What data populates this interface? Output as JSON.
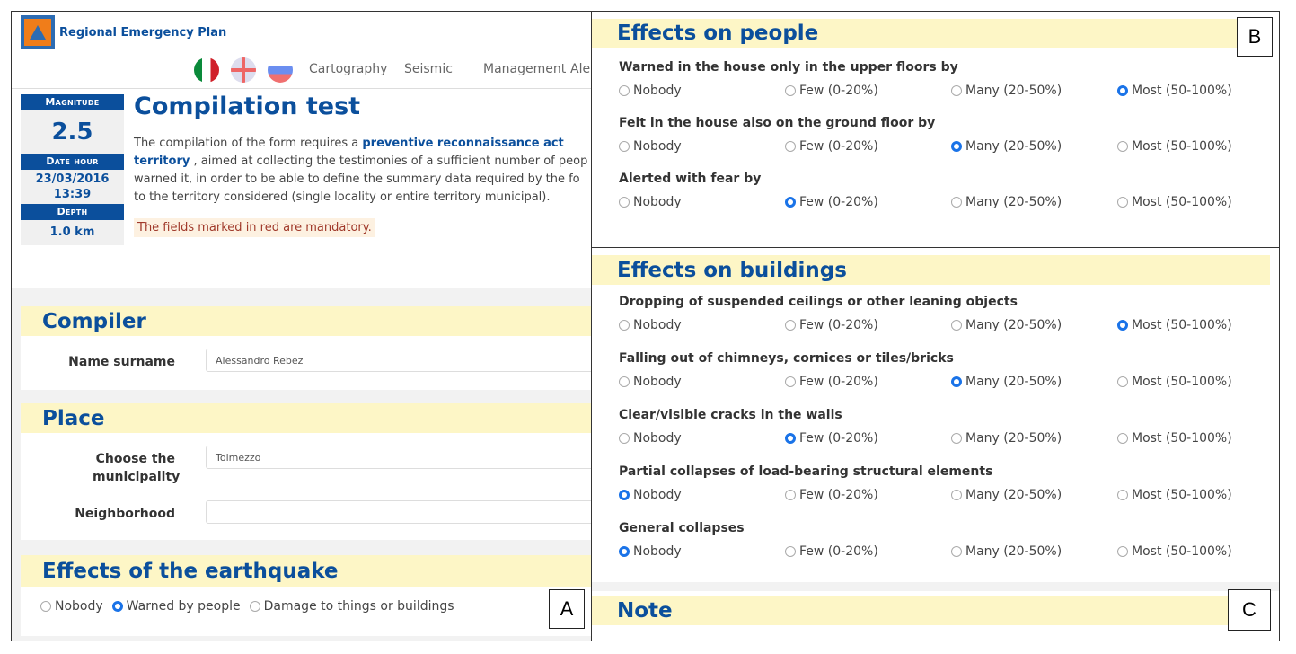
{
  "panel_a": {
    "label": "A",
    "app_title": "Regional Emergency Plan",
    "nav": [
      "Cartography",
      "Seismic",
      "Management",
      "Ale"
    ],
    "info": {
      "magnitude_label": "Magnitude",
      "magnitude": "2.5",
      "date_label": "Date hour",
      "date": "23/03/2016",
      "time": "13:39",
      "depth_label": "Depth",
      "depth": "1.0 km"
    },
    "title": "Compilation test",
    "intro": {
      "p1": "The compilation of the form requires a ",
      "link1": "preventive reconnaissance act",
      "p2": "",
      "link2": "territory",
      "p3": " , aimed at collecting the testimonies of a sufficient number of peop",
      "p4": "warned it, in order to be able to define the summary data required by the fo",
      "p5": "to the territory considered (single locality or entire territory municipal)."
    },
    "mandatory_note": "The fields marked in red are mandatory.",
    "compiler": {
      "title": "Compiler",
      "name_label": "Name surname",
      "name_value": "Alessandro Rebez"
    },
    "place": {
      "title": "Place",
      "municipality_label": "Choose the municipality",
      "municipality_value": "Tolmezzo",
      "neighborhood_label": "Neighborhood",
      "neighborhood_value": ""
    },
    "effects": {
      "title": "Effects of the earthquake",
      "options": [
        "Nobody",
        "Warned by people",
        "Damage to things or buildings"
      ],
      "selected": 1
    }
  },
  "options": [
    "Nobody",
    "Few (0-20%)",
    "Many (20-50%)",
    "Most (50-100%)"
  ],
  "panel_b": {
    "label": "B",
    "title": "Effects on people",
    "questions": [
      {
        "text": "Warned in the house only in the upper floors by",
        "selected": 3
      },
      {
        "text": "Felt in the house also on the ground floor by",
        "selected": 2
      },
      {
        "text": "Alerted with fear by",
        "selected": 1
      }
    ]
  },
  "panel_c": {
    "label": "C",
    "title": "Effects on buildings",
    "note_title": "Note",
    "questions": [
      {
        "text": "Dropping of suspended ceilings or other leaning objects",
        "selected": 3
      },
      {
        "text": "Falling out of chimneys, cornices or tiles/bricks",
        "selected": 2
      },
      {
        "text": "Clear/visible cracks in the walls",
        "selected": 1
      },
      {
        "text": "Partial collapses of load-bearing structural elements",
        "selected": 0
      },
      {
        "text": "General collapses",
        "selected": 0
      }
    ]
  },
  "colors": {
    "accent": "#0b4f9c",
    "header_bg": "#fdf6c6",
    "radio_on": "#1a73e8",
    "mandatory": "#a0392a"
  }
}
